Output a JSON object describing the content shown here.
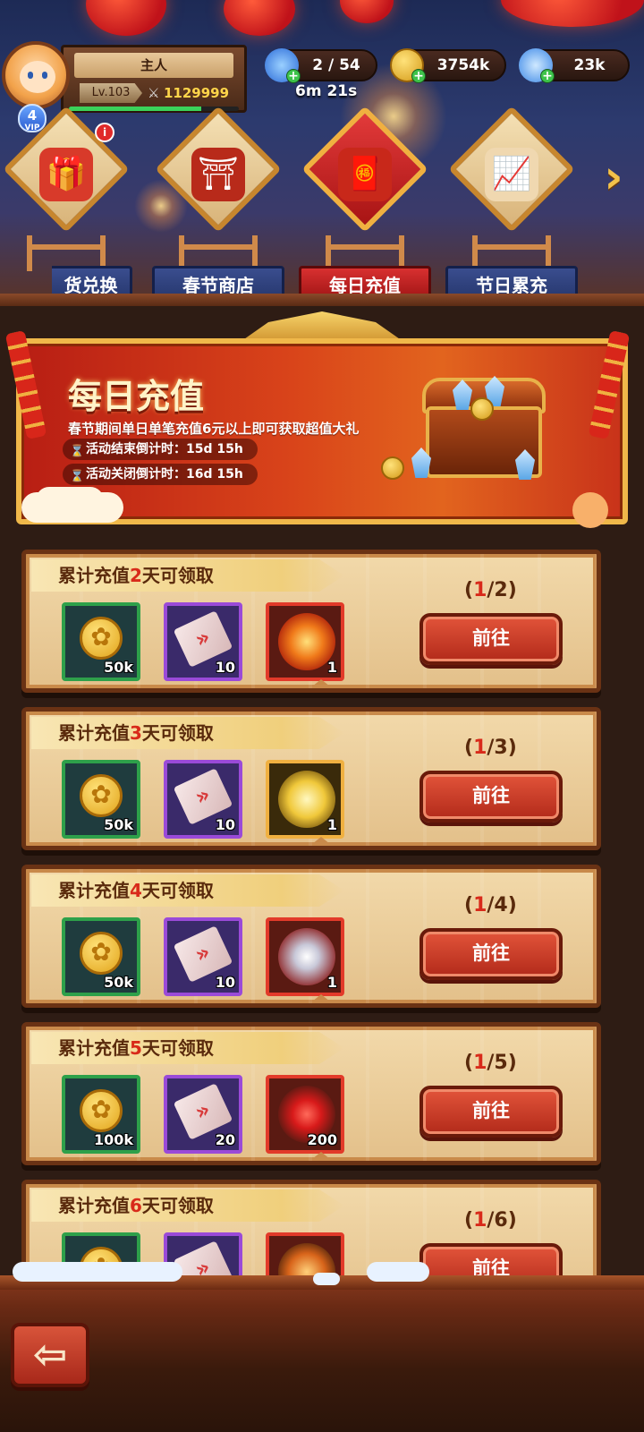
{
  "player": {
    "name": "主人",
    "level": "Lv.103",
    "power": "1129999",
    "vip_level": "4",
    "vip_label": "VIP",
    "exp_progress": 0.78
  },
  "resources": {
    "stars": "2 / 54",
    "coins": "3754k",
    "gems": "23k",
    "timer": "6m 21s"
  },
  "nav": {
    "prev_arrow": "‹",
    "next_arrow": "›",
    "badge": "i",
    "tabs": [
      {
        "label": "货兑换",
        "icon": "gift-bag-icon",
        "active": false
      },
      {
        "label": "春节商店",
        "icon": "shop-gate-icon",
        "active": false
      },
      {
        "label": "每日充值",
        "icon": "red-envelope-coins-icon",
        "active": true
      },
      {
        "label": "节日累充",
        "icon": "chart-coins-icon",
        "active": false
      }
    ]
  },
  "banner": {
    "title": "每日充值",
    "description": "春节期间单日单笔充值6元以上即可获取超值大礼",
    "end_countdown": "活动结束倒计时：15d 15h",
    "close_countdown": "活动关闭倒计时：16d 15h"
  },
  "rewards": [
    {
      "title_prefix": "累计充值",
      "days": "2",
      "title_suffix": "天可领取",
      "progress_current": "1",
      "progress_total": "/2)",
      "progress_open": "(",
      "button": "前往",
      "items": [
        {
          "type": "coin",
          "icon": "gold-coin-icon",
          "count": "50k",
          "frame": "green"
        },
        {
          "type": "ticket",
          "icon": "ticket-icon",
          "count": "10",
          "frame": "purple"
        },
        {
          "type": "skill",
          "icon": "fire-swirl-skill-icon",
          "count": "1",
          "frame": "red"
        }
      ]
    },
    {
      "title_prefix": "累计充值",
      "days": "3",
      "title_suffix": "天可领取",
      "progress_current": "1",
      "progress_total": "/3)",
      "progress_open": "(",
      "button": "前往",
      "items": [
        {
          "type": "coin",
          "icon": "gold-coin-icon",
          "count": "50k",
          "frame": "green"
        },
        {
          "type": "ticket",
          "icon": "ticket-icon",
          "count": "10",
          "frame": "purple"
        },
        {
          "type": "skill",
          "icon": "light-burst-skill-icon",
          "count": "1",
          "frame": "gold"
        }
      ]
    },
    {
      "title_prefix": "累计充值",
      "days": "4",
      "title_suffix": "天可领取",
      "progress_current": "1",
      "progress_total": "/4)",
      "progress_open": "(",
      "button": "前往",
      "items": [
        {
          "type": "coin",
          "icon": "gold-coin-icon",
          "count": "50k",
          "frame": "green"
        },
        {
          "type": "ticket",
          "icon": "ticket-icon",
          "count": "10",
          "frame": "purple"
        },
        {
          "type": "skill",
          "icon": "vortex-skill-icon",
          "count": "1",
          "frame": "red"
        }
      ]
    },
    {
      "title_prefix": "累计充值",
      "days": "5",
      "title_suffix": "天可领取",
      "progress_current": "1",
      "progress_total": "/5)",
      "progress_open": "(",
      "button": "前往",
      "items": [
        {
          "type": "coin",
          "icon": "gold-coin-icon",
          "count": "100k",
          "frame": "green"
        },
        {
          "type": "ticket",
          "icon": "ticket-icon",
          "count": "20",
          "frame": "purple"
        },
        {
          "type": "knot",
          "icon": "chinese-knot-icon",
          "count": "200",
          "frame": "red"
        }
      ]
    },
    {
      "title_prefix": "累计充值",
      "days": "6",
      "title_suffix": "天可领取",
      "progress_current": "1",
      "progress_total": "/6)",
      "progress_open": "(",
      "button": "前往",
      "items": [
        {
          "type": "coin",
          "icon": "gold-coin-icon",
          "count": "",
          "frame": "green"
        },
        {
          "type": "ticket",
          "icon": "ticket-icon",
          "count": "",
          "frame": "purple"
        },
        {
          "type": "skill",
          "icon": "spear-skill-icon",
          "count": "",
          "frame": "red"
        }
      ]
    }
  ],
  "back_button": {
    "icon": "back-arrow-icon",
    "glyph": "⇦"
  },
  "colors": {
    "accent_red": "#d82a1a",
    "gold": "#f0b040",
    "card_bg": "#f2d9aa"
  }
}
